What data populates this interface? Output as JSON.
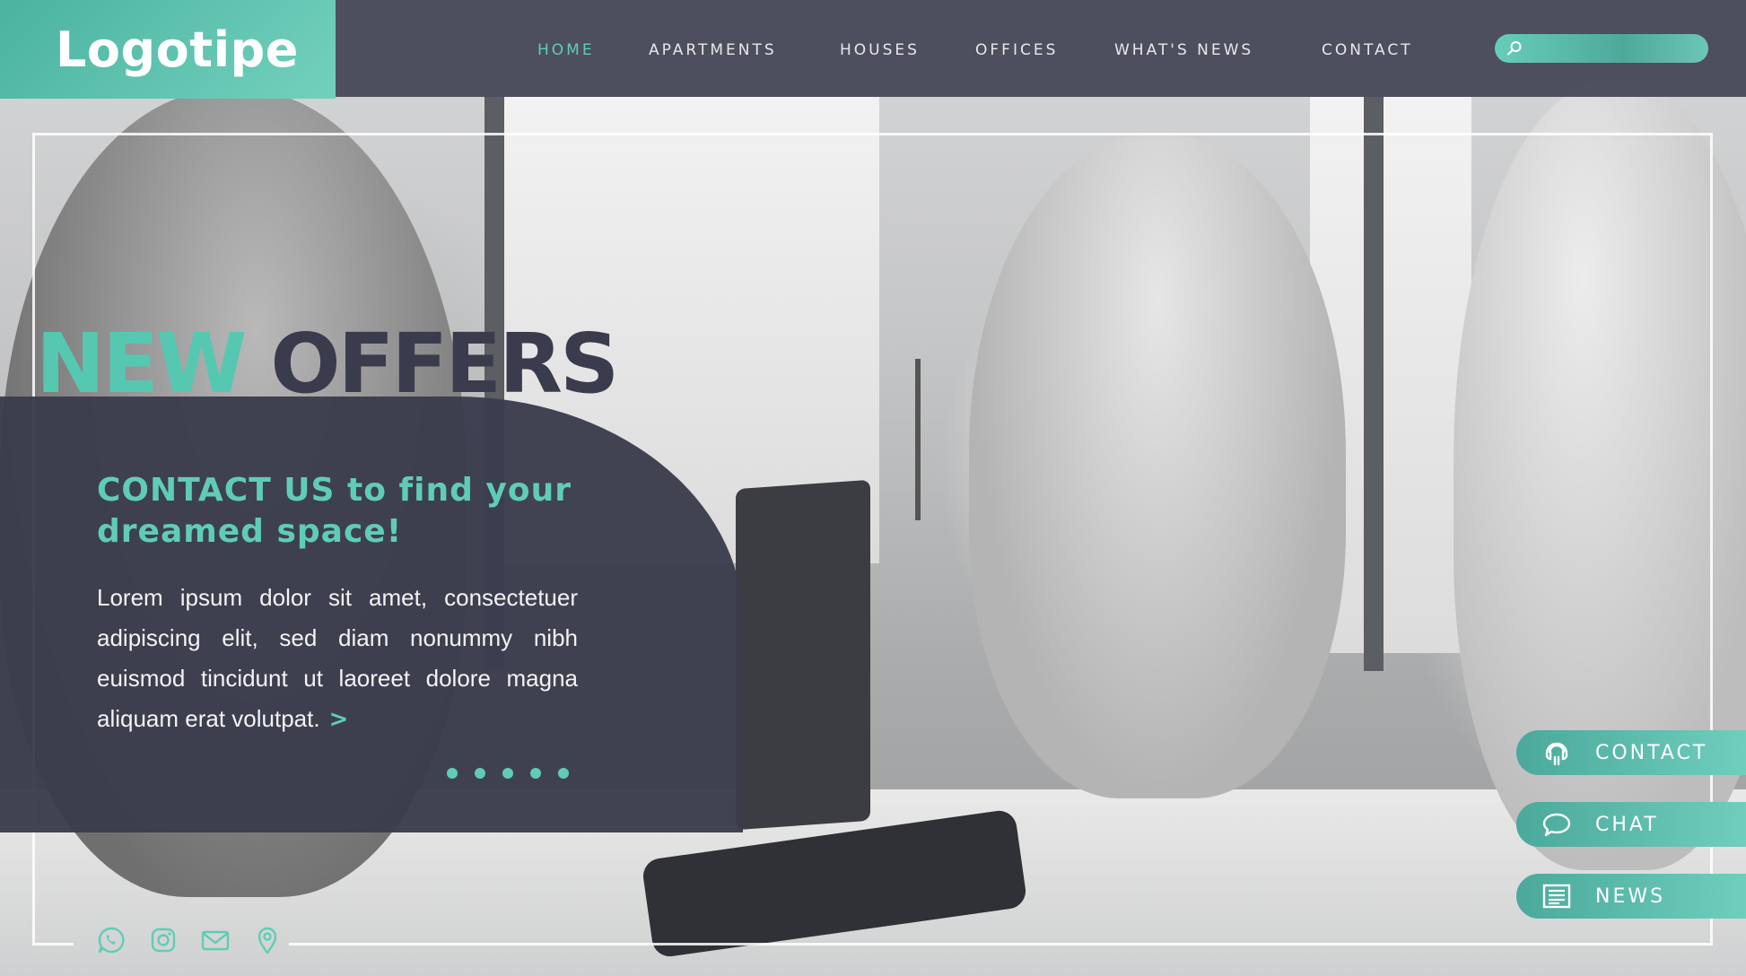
{
  "brand": {
    "logo_text": "Logotipe"
  },
  "nav": {
    "items": [
      {
        "label": "HOME",
        "active": true
      },
      {
        "label": "APARTMENTS",
        "active": false
      },
      {
        "label": "HOUSES",
        "active": false
      },
      {
        "label": "OFFICES",
        "active": false
      },
      {
        "label": "WHAT'S NEWS",
        "active": false
      },
      {
        "label": "CONTACT",
        "active": false
      }
    ]
  },
  "search": {
    "placeholder": "",
    "icon": "search-icon"
  },
  "hero": {
    "headline_accent": "NEW",
    "headline_main": "OFFERS",
    "panel_heading": "CONTACT US to find your dreamed space!",
    "panel_body": "Lorem ipsum dolor sit amet, consectetuer adipiscing elit, sed diam nonummy nibh euismod tincidunt ut laoreet dolore magna aliquam erat volutpat.",
    "more_symbol": ">",
    "slide_count": 5
  },
  "social": {
    "icons": [
      "whatsapp-icon",
      "instagram-icon",
      "mail-icon",
      "location-pin-icon"
    ]
  },
  "side_actions": [
    {
      "label": "CONTACT",
      "icon": "contact-icon"
    },
    {
      "label": "CHAT",
      "icon": "chat-bubble-icon"
    },
    {
      "label": "NEWS",
      "icon": "news-icon"
    }
  ],
  "colors": {
    "accent": "#5fcdb6",
    "dark": "#3a3c4d",
    "logo_bg": "#5cc4af",
    "text_light": "#f2f3f4"
  }
}
